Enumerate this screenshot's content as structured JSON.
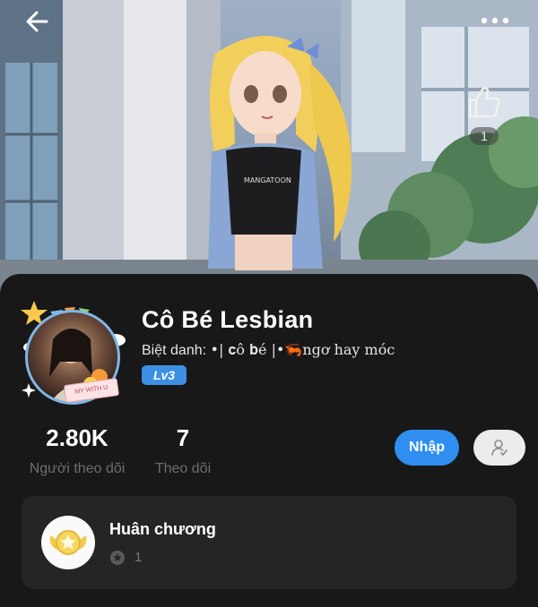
{
  "header": {
    "back_icon": "arrow-left-icon",
    "more_icon": "more-dots-icon",
    "like_icon": "thumbs-up-icon",
    "like_count": "1"
  },
  "profile": {
    "name": "Cô Bé Lesbian",
    "nickname_label": "Biệt danh:",
    "nickname_value": "•| 𝐜ô 𝐛é |•🦐ngơ hay móc",
    "level": "Lv3",
    "avatar_frame_text": "MY WITH U"
  },
  "stats": {
    "followers_value": "2.80K",
    "followers_label": "Người theo dõi",
    "following_value": "7",
    "following_label": "Theo dõi"
  },
  "actions": {
    "enter_label": "Nhập",
    "follow_icon": "person-check-icon"
  },
  "medals": {
    "title": "Huân chương",
    "count": "1",
    "medal_icon": "medal-badge-icon",
    "star_icon": "star-circle-icon"
  },
  "colors": {
    "accent_blue": "#2f8ef0",
    "level_badge": "#3d8fe3",
    "card_bg": "#181818",
    "panel_bg": "#252525"
  }
}
